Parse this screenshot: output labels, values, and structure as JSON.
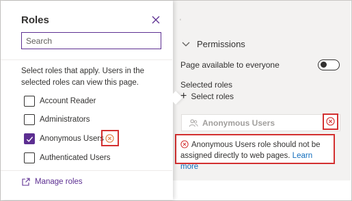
{
  "roles_panel": {
    "title": "Roles",
    "search_placeholder": "Search",
    "instructions": "Select roles that apply. Users in the selected roles can view this page.",
    "roles": [
      {
        "label": "Account Reader",
        "checked": false
      },
      {
        "label": "Administrators",
        "checked": false
      },
      {
        "label": "Anonymous Users",
        "checked": true
      },
      {
        "label": "Authenticated Users",
        "checked": false
      }
    ],
    "manage_roles_label": "Manage roles"
  },
  "permissions": {
    "section_title": "Permissions",
    "toggle_label": "Page available to everyone",
    "toggle_on": false,
    "selected_roles_label": "Selected roles",
    "select_roles_label": "Select roles",
    "selected_role_chip": "Anonymous Users",
    "error_message": "Anonymous Users role should not be assigned directly to web pages.",
    "learn_more_label": "Learn more"
  },
  "colors": {
    "accent": "#5c2e91",
    "error": "#d32f2f",
    "link": "#0f6cbd"
  },
  "icons": {
    "close": "close-icon",
    "chevron": "chevron-down-icon",
    "add": "plus-icon",
    "role": "people-icon",
    "error": "error-circle-icon",
    "manage": "external-link-icon"
  }
}
